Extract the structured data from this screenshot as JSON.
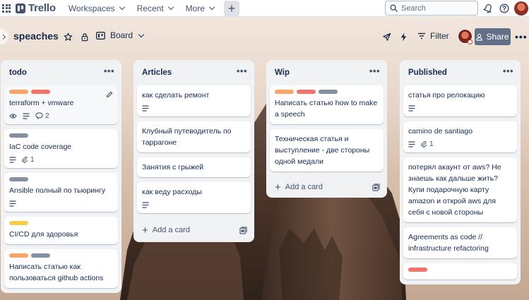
{
  "topnav": {
    "app_name": "Trello",
    "workspaces": "Workspaces",
    "recent": "Recent",
    "more": "More",
    "create": "+",
    "search_placeholder": "Search"
  },
  "board": {
    "title": "speaches",
    "view": "Board",
    "filter": "Filter",
    "share": "Share",
    "more": "•••"
  },
  "colors": {
    "orange": "#f5cd47",
    "yellow": "#f5cd47",
    "red": "#f87168",
    "gray": "#8590a2",
    "amber": "#fea362"
  },
  "lists": [
    {
      "title": "todo",
      "more": "•••",
      "cards": [
        {
          "labels": [
            "#fea362",
            "#f87168"
          ],
          "title": "terraform + vmware",
          "watch": true,
          "description": true,
          "comments": "2",
          "edit": true
        },
        {
          "labels": [
            "#8590a2"
          ],
          "title": "IaC code coverage",
          "description": true,
          "attachments": "1"
        },
        {
          "labels": [
            "#8590a2"
          ],
          "title": "Ansible полный по тьюрингу",
          "description": true
        },
        {
          "labels": [
            "#f5cd47"
          ],
          "title": "CI/CD для здоровья"
        },
        {
          "labels": [
            "#fea362",
            "#8590a2"
          ],
          "title": "Написать статью как пользоваться github actions"
        }
      ]
    },
    {
      "title": "Articles",
      "more": "•••",
      "cards": [
        {
          "labels": [],
          "title": "как сделать ремонт",
          "description": true
        },
        {
          "labels": [],
          "title": "Клубный путеводитель по таррагоне"
        },
        {
          "labels": [],
          "title": "Занятия с грыжей"
        },
        {
          "labels": [],
          "title": "как веду расходы",
          "description": true
        }
      ],
      "add_card": "Add a card"
    },
    {
      "title": "Wip",
      "more": "•••",
      "cards": [
        {
          "labels": [
            "#fea362",
            "#f87168",
            "#8590a2"
          ],
          "title": "Написать статью how to make a speech"
        },
        {
          "labels": [],
          "title": "Техническая статья и выступление - две стороны одной медали"
        }
      ],
      "add_card": "Add a card"
    },
    {
      "title": "Published",
      "more": "•••",
      "cards": [
        {
          "labels": [],
          "title": "статья про релокацию",
          "description": true
        },
        {
          "labels": [],
          "title": "camino de santiago",
          "description": true,
          "attachments": "1"
        },
        {
          "labels": [],
          "title": "потерял акаунт от aws? Не знаешь как дальше жить? Купи подарочную карту amazon и открой aws для себя с новой стороны"
        },
        {
          "labels": [],
          "title": "Agreements as code // infrastructure refactoring"
        },
        {
          "labels": [
            "#f87168"
          ],
          "title": ""
        }
      ]
    }
  ]
}
